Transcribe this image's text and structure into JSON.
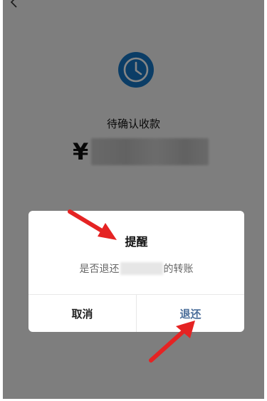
{
  "page": {
    "status_text": "待确认收款",
    "currency_symbol": "¥"
  },
  "dialog": {
    "title": "提醒",
    "message_prefix": "是否退还",
    "message_suffix": "的转账",
    "cancel_label": "取消",
    "confirm_label": "退还"
  },
  "colors": {
    "clock": "#1676c4",
    "confirm_text": "#4a6d99",
    "annotation_arrow": "#e52323"
  },
  "icons": {
    "back": "chevron-left-icon",
    "status": "clock-icon"
  }
}
